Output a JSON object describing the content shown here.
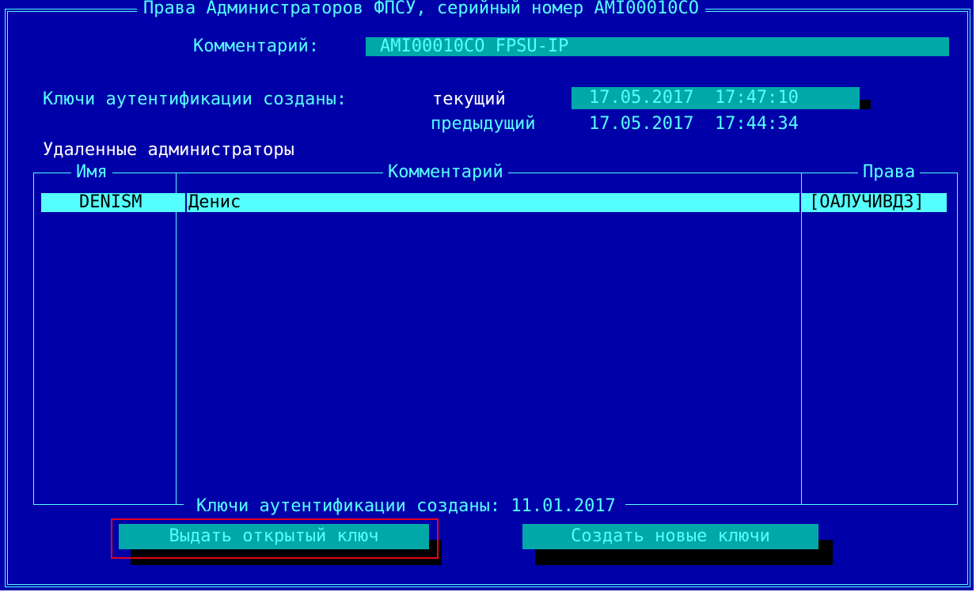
{
  "window": {
    "title": "Права Администраторов ФПСУ, серийный номер AMI00010CO"
  },
  "comment": {
    "label": "Комментарий:",
    "value": "AMI00010CO FPSU-IP"
  },
  "auth_keys": {
    "label": "Ключи аутентификации созданы:",
    "current_label": "текущий",
    "current_value": "17.05.2017  17:47:10",
    "previous_label": "предыдущий",
    "previous_value": "17.05.2017  17:44:34"
  },
  "remote_admins": {
    "heading": "Удаленные администраторы",
    "columns": {
      "name": "Имя",
      "comment": "Комментарий",
      "rights": "Права"
    },
    "rows": [
      {
        "name": "DENISM",
        "comment": "Денис",
        "rights": "[ОАЛУЧИВДЗ]"
      }
    ],
    "footer": "Ключи аутентификации созданы: 11.01.2017"
  },
  "buttons": {
    "issue_public_key": "Выдать открытый ключ",
    "create_new_keys": "Создать новые ключи"
  },
  "colors": {
    "background": "#0000a8",
    "text": "#55ffff",
    "field": "#00a8a8",
    "highlight": "#55ffff",
    "annotation": "#e8001a"
  }
}
